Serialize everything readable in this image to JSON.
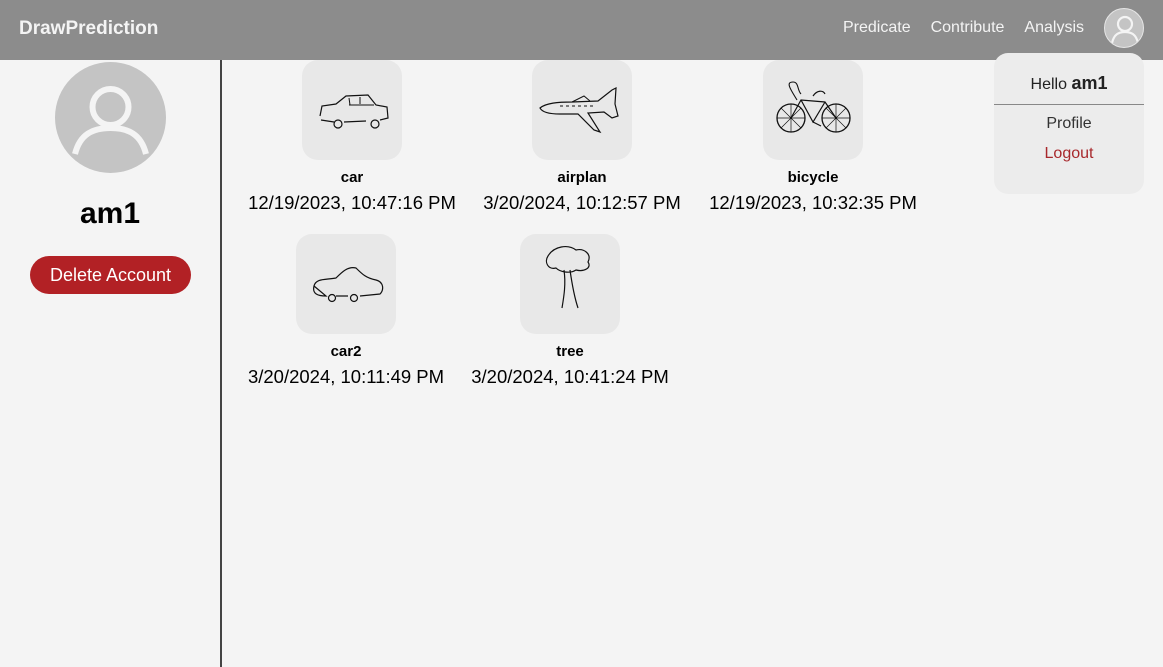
{
  "navbar": {
    "brand": "DrawPrediction",
    "links": [
      "Predicate",
      "Contribute",
      "Analysis"
    ],
    "avatar_icon": "user-avatar-icon"
  },
  "profile": {
    "avatar_icon": "user-avatar-icon",
    "username": "am1",
    "delete_label": "Delete Account"
  },
  "drawings": [
    {
      "name": "car",
      "date": "12/19/2023, 10:47:16 PM",
      "icon": "car-sketch"
    },
    {
      "name": "airplan",
      "date": "3/20/2024, 10:12:57 PM",
      "icon": "airplane-sketch"
    },
    {
      "name": "bicycle",
      "date": "12/19/2023, 10:32:35 PM",
      "icon": "bicycle-sketch"
    },
    {
      "name": "car2",
      "date": "3/20/2024, 10:11:49 PM",
      "icon": "car-sketch"
    },
    {
      "name": "tree",
      "date": "3/20/2024, 10:41:24 PM",
      "icon": "tree-sketch"
    }
  ],
  "dropdown": {
    "greeting": "Hello",
    "username": "am1",
    "profile_label": "Profile",
    "logout_label": "Logout"
  },
  "colors": {
    "navbar": "#8c8c8c",
    "danger": "#b22125",
    "logout": "#a8282c",
    "background": "#f4f4f4"
  }
}
